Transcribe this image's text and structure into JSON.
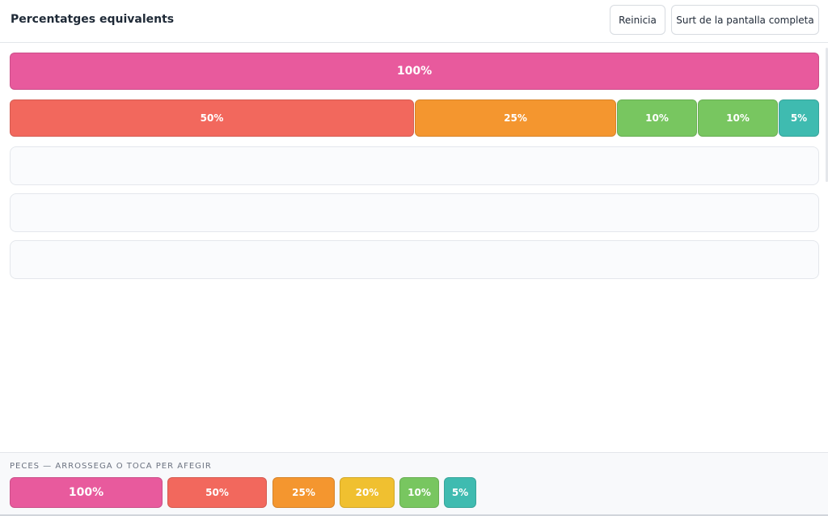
{
  "header": {
    "title": "Percentatges equivalents",
    "reset_label": "Reinicia",
    "fullscreen_label": "Surt de la pantalla completa"
  },
  "colors": {
    "p100": "#e85a9d",
    "p50": "#f2685d",
    "p25": "#f4962f",
    "p20": "#f0c030",
    "p10": "#78c660",
    "p5": "#3fbbb0"
  },
  "rows": [
    {
      "pieces": [
        {
          "label": "100%",
          "percent": 100,
          "color": "#e85a9d"
        }
      ]
    },
    {
      "pieces": [
        {
          "label": "50%",
          "percent": 50,
          "color": "#f2685d"
        },
        {
          "label": "25%",
          "percent": 25,
          "color": "#f4962f"
        },
        {
          "label": "10%",
          "percent": 10,
          "color": "#78c660"
        },
        {
          "label": "10%",
          "percent": 10,
          "color": "#78c660"
        },
        {
          "label": "5%",
          "percent": 5,
          "color": "#3fbbb0"
        }
      ]
    },
    {
      "pieces": []
    },
    {
      "pieces": []
    },
    {
      "pieces": []
    }
  ],
  "tray": {
    "label": "PECES — ARROSSEGA O TOCA PER AFEGIR",
    "pieces": [
      {
        "label": "100%",
        "color": "#e85a9d"
      },
      {
        "label": "50%",
        "color": "#f2685d"
      },
      {
        "label": "25%",
        "color": "#f4962f"
      },
      {
        "label": "20%",
        "color": "#f0c030"
      },
      {
        "label": "10%",
        "color": "#78c660"
      },
      {
        "label": "5%",
        "color": "#3fbbb0"
      }
    ]
  }
}
